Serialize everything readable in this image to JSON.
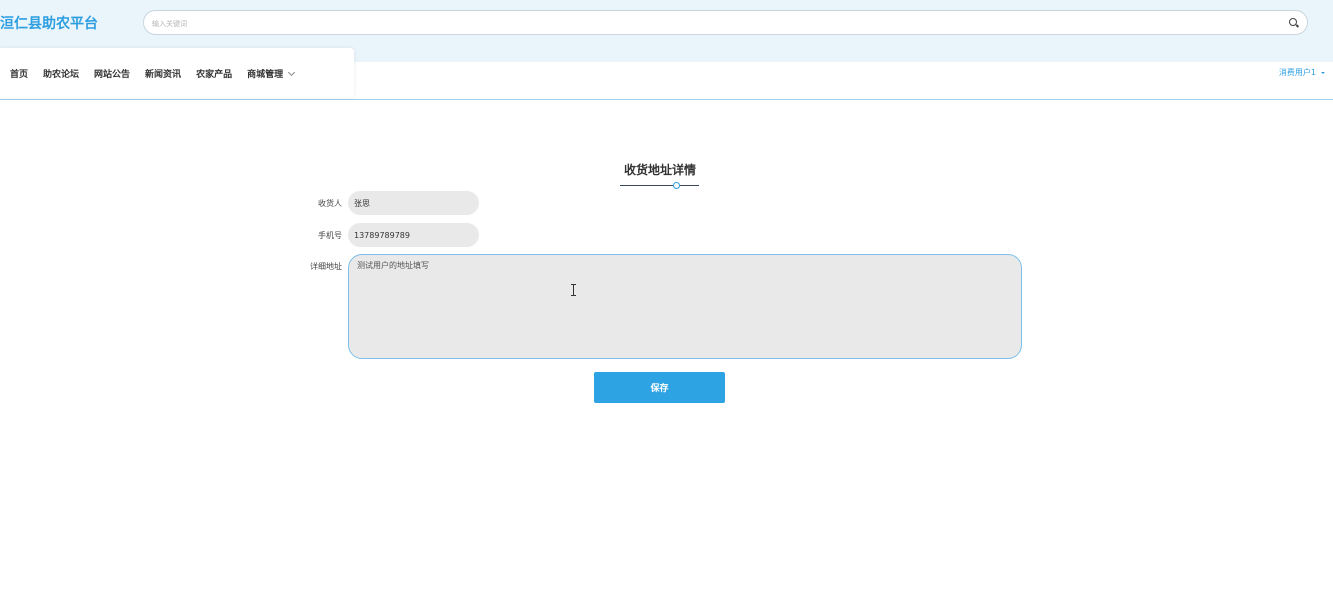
{
  "header": {
    "logo_text": "洹仁县助农平台",
    "search": {
      "placeholder": "输入关键词",
      "value": ""
    }
  },
  "nav": {
    "items": [
      {
        "label": "首页"
      },
      {
        "label": "助农论坛"
      },
      {
        "label": "网站公告"
      },
      {
        "label": "新闻资讯"
      },
      {
        "label": "农家产品"
      },
      {
        "label": "商城管理"
      }
    ],
    "user_label": "消费用户1"
  },
  "page": {
    "title": "收货地址详情"
  },
  "form": {
    "receiver": {
      "label": "收货人",
      "value": "张思"
    },
    "phone": {
      "label": "手机号",
      "value": "13789789789"
    },
    "address": {
      "label": "详细地址",
      "value": "测试用户的地址填写"
    },
    "save_label": "保存"
  },
  "colors": {
    "accent": "#2ea3e3",
    "topbar_bg": "#e9f4fb",
    "input_bg": "#e9e9e9"
  }
}
